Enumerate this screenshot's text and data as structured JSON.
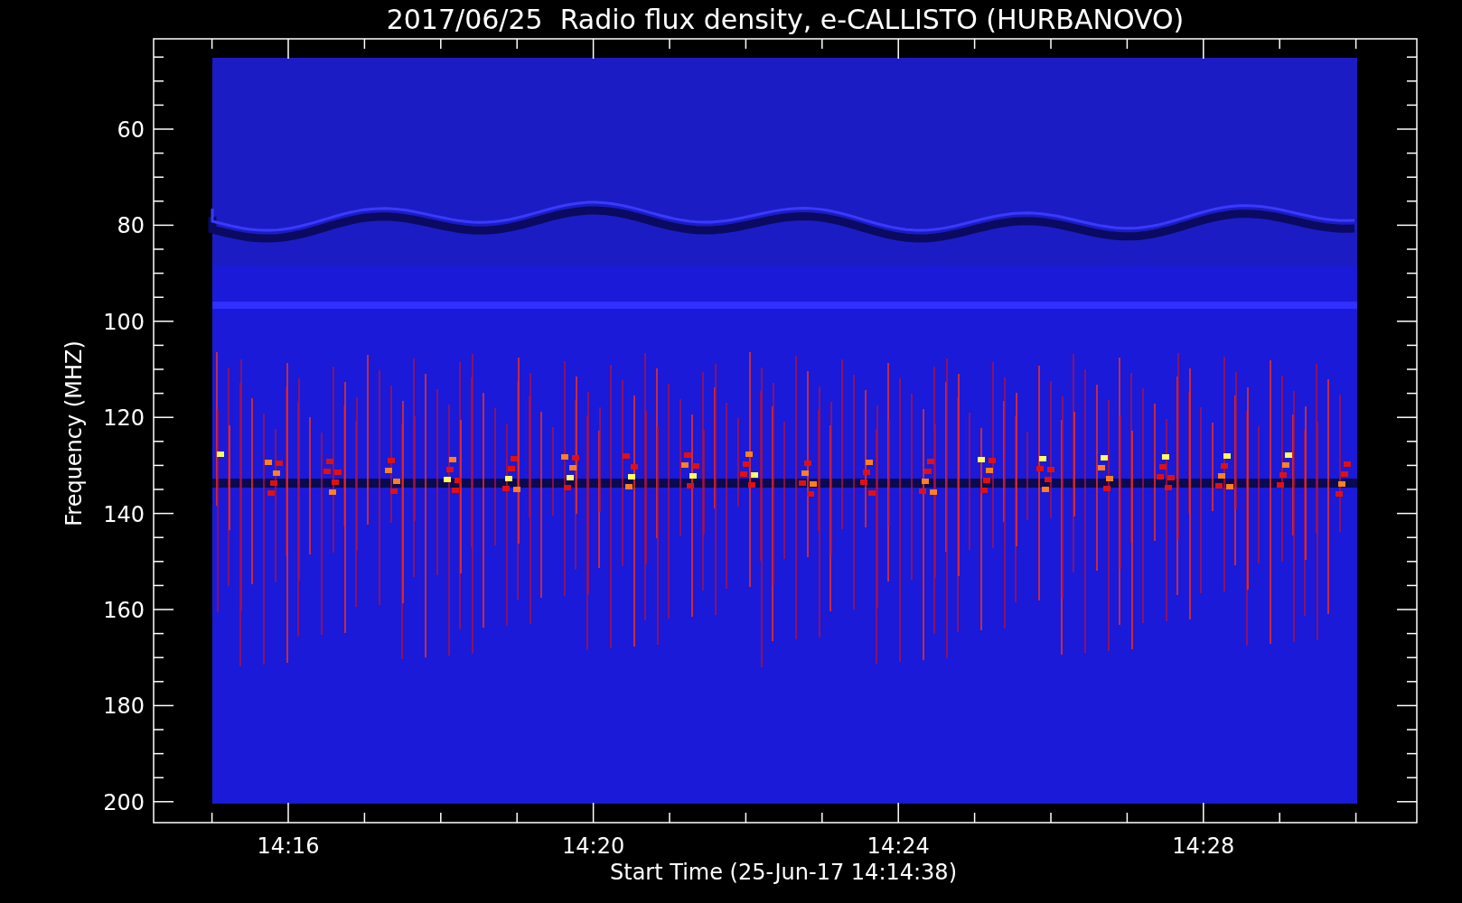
{
  "title": "2017/06/25  Radio flux density, e-CALLISTO (HURBANOVO)",
  "y_axis": {
    "label": "Frequency (MHZ)",
    "ticks": [
      "60",
      "80",
      "100",
      "120",
      "140",
      "160",
      "180",
      "200"
    ]
  },
  "x_axis": {
    "label": "Start Time (25-Jun-17 14:14:38)",
    "ticks": [
      "14:16",
      "14:20",
      "14:24",
      "14:28"
    ]
  }
}
